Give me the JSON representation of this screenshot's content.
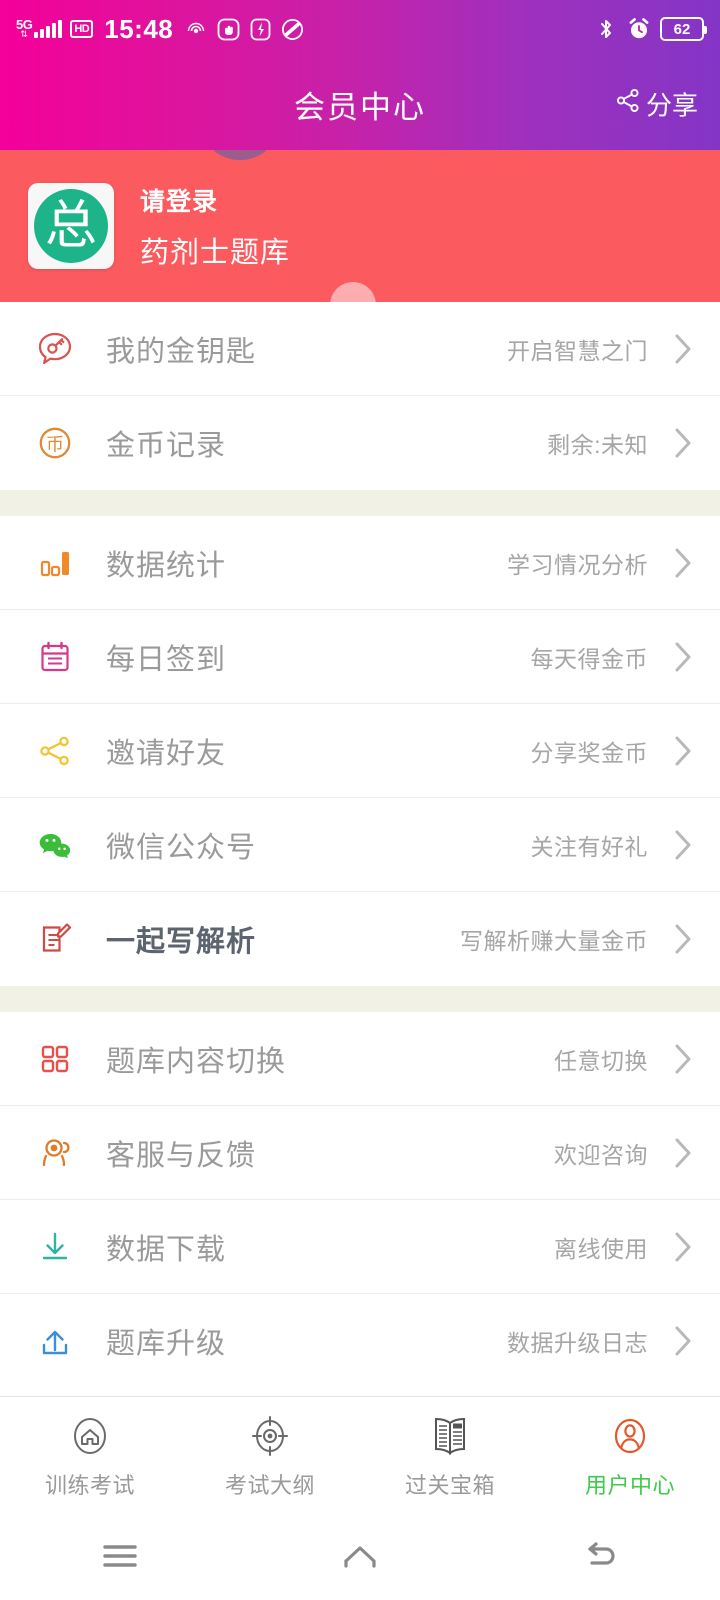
{
  "status_bar": {
    "network_type": "5G",
    "hd_label": "HD",
    "time": "15:48",
    "battery_level": "62",
    "icons_left": [
      "signal-bars-icon",
      "hd-icon",
      "hotspot-icon",
      "gesture-icon",
      "flash-icon",
      "dnd-icon"
    ],
    "icons_right": [
      "bluetooth-icon",
      "alarm-icon",
      "battery-icon"
    ]
  },
  "header": {
    "title": "会员中心",
    "share_label": "分享",
    "share_icon": "share-icon",
    "gradient_start": "#f4009a",
    "gradient_end": "#8435c6"
  },
  "profile": {
    "avatar_glyph": "总",
    "avatar_bg": "#1db48a",
    "login_prompt": "请登录",
    "app_name": "药剂士题库",
    "background": "#fb5a5f"
  },
  "groups": [
    {
      "items": [
        {
          "icon": "key-bubble-icon",
          "icon_color": "#d9534f",
          "label": "我的金钥匙",
          "value": "开启智慧之门",
          "bold": false
        },
        {
          "icon": "coin-icon",
          "icon_color": "#e08a33",
          "label": "金币记录",
          "value": "剩余:未知",
          "bold": false
        }
      ]
    },
    {
      "items": [
        {
          "icon": "bar-chart-icon",
          "icon_color": "#ef8a2b",
          "label": "数据统计",
          "value": "学习情况分析",
          "bold": false
        },
        {
          "icon": "calendar-icon",
          "icon_color": "#d6398a",
          "label": "每日签到",
          "value": "每天得金币",
          "bold": false
        },
        {
          "icon": "share-nodes-icon",
          "icon_color": "#f2c335",
          "label": "邀请好友",
          "value": "分享奖金币",
          "bold": false
        },
        {
          "icon": "wechat-icon",
          "icon_color": "#3bbd3b",
          "label": "微信公众号",
          "value": "关注有好礼",
          "bold": false
        },
        {
          "icon": "edit-note-icon",
          "icon_color": "#cf4b44",
          "label": "一起写解析",
          "value": "写解析赚大量金币",
          "bold": true
        }
      ]
    },
    {
      "items": [
        {
          "icon": "grid-icon",
          "icon_color": "#e8514b",
          "label": "题库内容切换",
          "value": "任意切换",
          "bold": false
        },
        {
          "icon": "support-icon",
          "icon_color": "#e07b28",
          "label": "客服与反馈",
          "value": "欢迎咨询",
          "bold": false
        },
        {
          "icon": "download-icon",
          "icon_color": "#2bb5a5",
          "label": "数据下载",
          "value": "离线使用",
          "bold": false
        },
        {
          "icon": "upload-icon",
          "icon_color": "#3b8fd6",
          "label": "题库升级",
          "value": "数据升级日志",
          "bold": false
        }
      ]
    }
  ],
  "tabs": [
    {
      "icon": "home-icon",
      "label": "训练考试",
      "active": false
    },
    {
      "icon": "target-icon",
      "label": "考试大纲",
      "active": false
    },
    {
      "icon": "newspaper-icon",
      "label": "过关宝箱",
      "active": false
    },
    {
      "icon": "user-icon",
      "label": "用户中心",
      "active": true
    }
  ],
  "tab_active_color": "#3ecb4b",
  "tab_active_icon_color": "#e4582a",
  "system_nav": [
    {
      "icon": "recents-icon"
    },
    {
      "icon": "home-nav-icon"
    },
    {
      "icon": "back-icon"
    }
  ]
}
